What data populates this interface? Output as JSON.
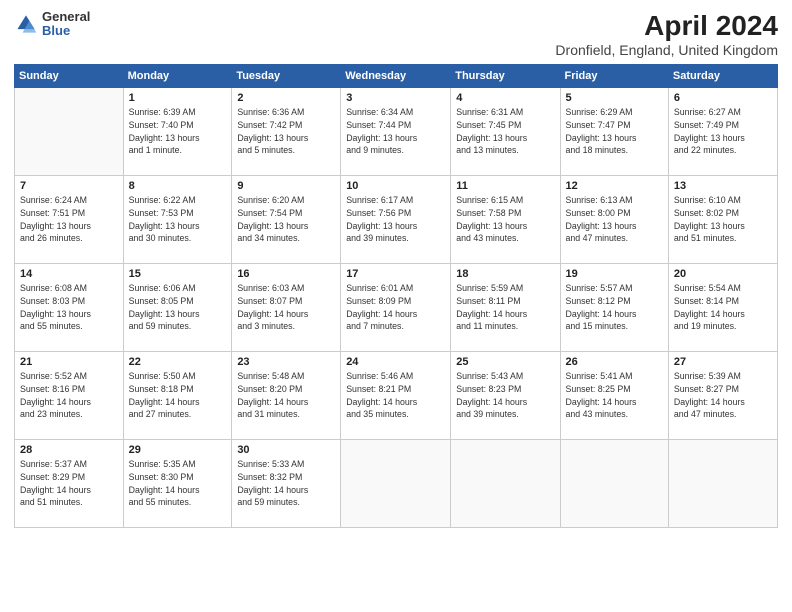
{
  "logo": {
    "general": "General",
    "blue": "Blue"
  },
  "title": "April 2024",
  "subtitle": "Dronfield, England, United Kingdom",
  "days_header": [
    "Sunday",
    "Monday",
    "Tuesday",
    "Wednesday",
    "Thursday",
    "Friday",
    "Saturday"
  ],
  "weeks": [
    [
      {
        "day": "",
        "info": ""
      },
      {
        "day": "1",
        "info": "Sunrise: 6:39 AM\nSunset: 7:40 PM\nDaylight: 13 hours\nand 1 minute."
      },
      {
        "day": "2",
        "info": "Sunrise: 6:36 AM\nSunset: 7:42 PM\nDaylight: 13 hours\nand 5 minutes."
      },
      {
        "day": "3",
        "info": "Sunrise: 6:34 AM\nSunset: 7:44 PM\nDaylight: 13 hours\nand 9 minutes."
      },
      {
        "day": "4",
        "info": "Sunrise: 6:31 AM\nSunset: 7:45 PM\nDaylight: 13 hours\nand 13 minutes."
      },
      {
        "day": "5",
        "info": "Sunrise: 6:29 AM\nSunset: 7:47 PM\nDaylight: 13 hours\nand 18 minutes."
      },
      {
        "day": "6",
        "info": "Sunrise: 6:27 AM\nSunset: 7:49 PM\nDaylight: 13 hours\nand 22 minutes."
      }
    ],
    [
      {
        "day": "7",
        "info": "Sunrise: 6:24 AM\nSunset: 7:51 PM\nDaylight: 13 hours\nand 26 minutes."
      },
      {
        "day": "8",
        "info": "Sunrise: 6:22 AM\nSunset: 7:53 PM\nDaylight: 13 hours\nand 30 minutes."
      },
      {
        "day": "9",
        "info": "Sunrise: 6:20 AM\nSunset: 7:54 PM\nDaylight: 13 hours\nand 34 minutes."
      },
      {
        "day": "10",
        "info": "Sunrise: 6:17 AM\nSunset: 7:56 PM\nDaylight: 13 hours\nand 39 minutes."
      },
      {
        "day": "11",
        "info": "Sunrise: 6:15 AM\nSunset: 7:58 PM\nDaylight: 13 hours\nand 43 minutes."
      },
      {
        "day": "12",
        "info": "Sunrise: 6:13 AM\nSunset: 8:00 PM\nDaylight: 13 hours\nand 47 minutes."
      },
      {
        "day": "13",
        "info": "Sunrise: 6:10 AM\nSunset: 8:02 PM\nDaylight: 13 hours\nand 51 minutes."
      }
    ],
    [
      {
        "day": "14",
        "info": "Sunrise: 6:08 AM\nSunset: 8:03 PM\nDaylight: 13 hours\nand 55 minutes."
      },
      {
        "day": "15",
        "info": "Sunrise: 6:06 AM\nSunset: 8:05 PM\nDaylight: 13 hours\nand 59 minutes."
      },
      {
        "day": "16",
        "info": "Sunrise: 6:03 AM\nSunset: 8:07 PM\nDaylight: 14 hours\nand 3 minutes."
      },
      {
        "day": "17",
        "info": "Sunrise: 6:01 AM\nSunset: 8:09 PM\nDaylight: 14 hours\nand 7 minutes."
      },
      {
        "day": "18",
        "info": "Sunrise: 5:59 AM\nSunset: 8:11 PM\nDaylight: 14 hours\nand 11 minutes."
      },
      {
        "day": "19",
        "info": "Sunrise: 5:57 AM\nSunset: 8:12 PM\nDaylight: 14 hours\nand 15 minutes."
      },
      {
        "day": "20",
        "info": "Sunrise: 5:54 AM\nSunset: 8:14 PM\nDaylight: 14 hours\nand 19 minutes."
      }
    ],
    [
      {
        "day": "21",
        "info": "Sunrise: 5:52 AM\nSunset: 8:16 PM\nDaylight: 14 hours\nand 23 minutes."
      },
      {
        "day": "22",
        "info": "Sunrise: 5:50 AM\nSunset: 8:18 PM\nDaylight: 14 hours\nand 27 minutes."
      },
      {
        "day": "23",
        "info": "Sunrise: 5:48 AM\nSunset: 8:20 PM\nDaylight: 14 hours\nand 31 minutes."
      },
      {
        "day": "24",
        "info": "Sunrise: 5:46 AM\nSunset: 8:21 PM\nDaylight: 14 hours\nand 35 minutes."
      },
      {
        "day": "25",
        "info": "Sunrise: 5:43 AM\nSunset: 8:23 PM\nDaylight: 14 hours\nand 39 minutes."
      },
      {
        "day": "26",
        "info": "Sunrise: 5:41 AM\nSunset: 8:25 PM\nDaylight: 14 hours\nand 43 minutes."
      },
      {
        "day": "27",
        "info": "Sunrise: 5:39 AM\nSunset: 8:27 PM\nDaylight: 14 hours\nand 47 minutes."
      }
    ],
    [
      {
        "day": "28",
        "info": "Sunrise: 5:37 AM\nSunset: 8:29 PM\nDaylight: 14 hours\nand 51 minutes."
      },
      {
        "day": "29",
        "info": "Sunrise: 5:35 AM\nSunset: 8:30 PM\nDaylight: 14 hours\nand 55 minutes."
      },
      {
        "day": "30",
        "info": "Sunrise: 5:33 AM\nSunset: 8:32 PM\nDaylight: 14 hours\nand 59 minutes."
      },
      {
        "day": "",
        "info": ""
      },
      {
        "day": "",
        "info": ""
      },
      {
        "day": "",
        "info": ""
      },
      {
        "day": "",
        "info": ""
      }
    ]
  ]
}
